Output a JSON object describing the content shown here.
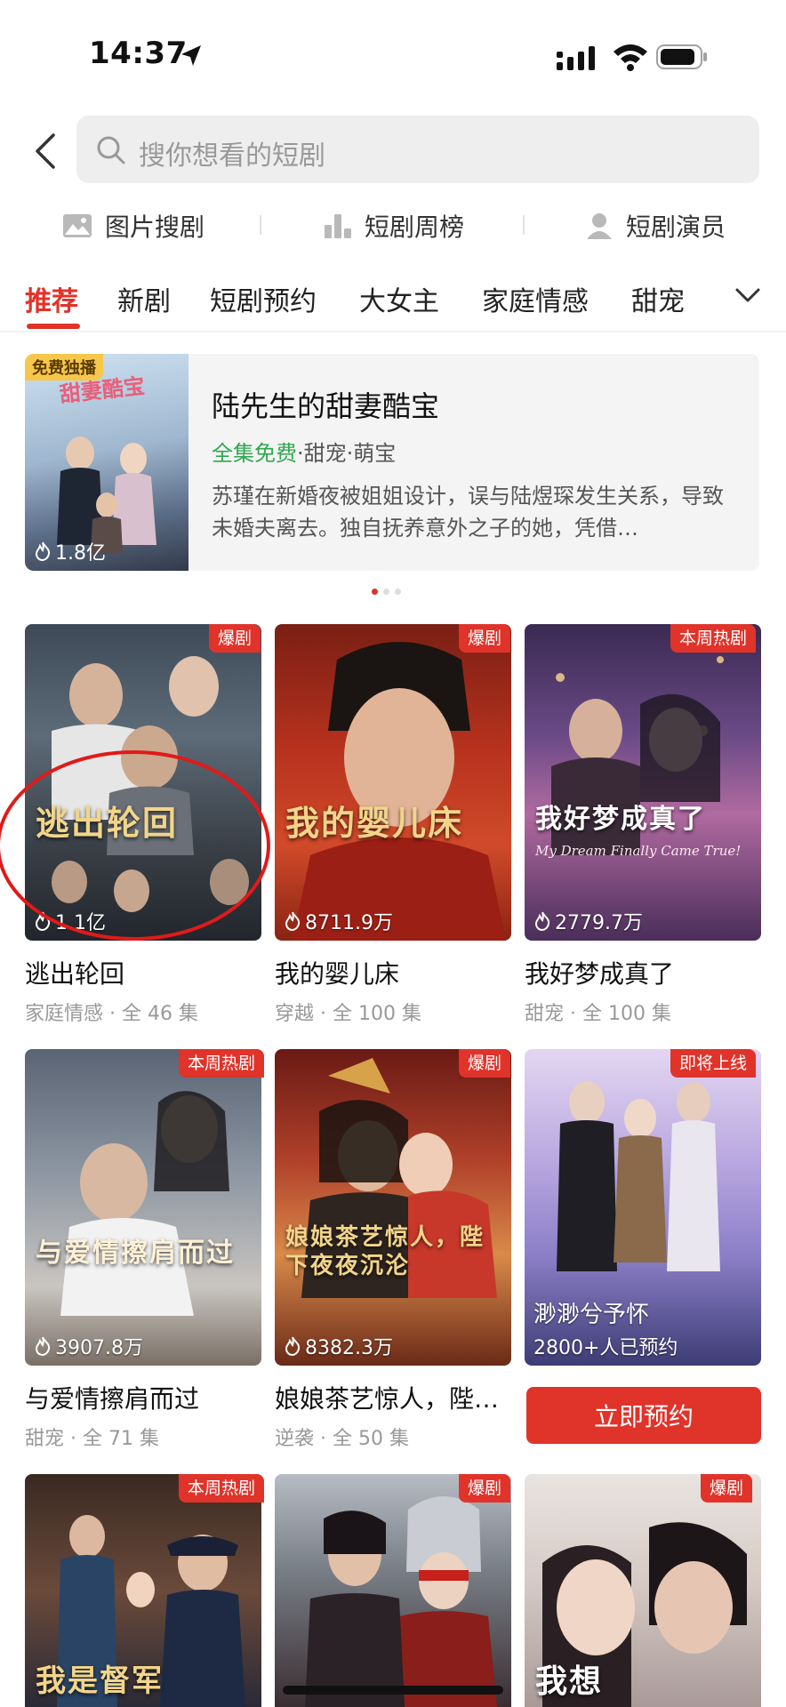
{
  "status_bar": {
    "time": "14:37"
  },
  "search": {
    "placeholder": "搜你想看的短剧"
  },
  "quick_entries": [
    {
      "label": "图片搜剧",
      "icon": "image-icon"
    },
    {
      "label": "短剧周榜",
      "icon": "bar-chart-icon"
    },
    {
      "label": "短剧演员",
      "icon": "person-icon"
    }
  ],
  "tabs": [
    "推荐",
    "新剧",
    "短剧预约",
    "大女主",
    "家庭情感",
    "甜宠"
  ],
  "active_tab": "推荐",
  "banner": {
    "badge": "免费独播",
    "views": "1.8亿",
    "title": "陆先生的甜妻酷宝",
    "free_tag": "全集免费",
    "tags": "·甜宠·萌宝",
    "description": "苏瑾在新婚夜被姐姐设计，误与陆煜琛发生关系，导致未婚夫离去。独自抚养意外之子的她，凭借…"
  },
  "grid": [
    {
      "badge": "爆剧",
      "views": "1.1亿",
      "name": "逃出轮回",
      "meta": "家庭情感 · 全 46 集",
      "poster_text": "逃出轮回"
    },
    {
      "badge": "爆剧",
      "views": "8711.9万",
      "name": "我的婴儿床",
      "meta": "穿越 · 全 100 集",
      "poster_text": "我的婴儿床"
    },
    {
      "badge": "本周热剧",
      "views": "2779.7万",
      "name": "我好梦成真了",
      "meta": "甜宠 · 全 100 集",
      "poster_text": "我好梦成真了",
      "poster_sub": "My Dream Finally Came True!"
    },
    {
      "badge": "本周热剧",
      "views": "3907.8万",
      "name": "与爱情擦肩而过",
      "meta": "甜宠 · 全 71 集",
      "poster_text": "与爱情擦肩而过"
    },
    {
      "badge": "爆剧",
      "views": "8382.3万",
      "name": "娘娘茶艺惊人，陛…",
      "meta": "逆袭 · 全 50 集",
      "poster_text": "娘娘茶艺惊人，陛下夜夜沉沦"
    },
    {
      "badge": "即将上线",
      "name": "渺渺兮予怀",
      "reserve_count": "2800+人已预约",
      "button": "立即预约"
    },
    {
      "badge": "本周热剧",
      "poster_text": "我是督军"
    },
    {
      "badge": "爆剧"
    },
    {
      "badge": "爆剧",
      "poster_text": "我想"
    }
  ],
  "colors": {
    "accent": "#e0332a",
    "free_green": "#2fa84f",
    "badge_gold": "#f6c74a"
  }
}
